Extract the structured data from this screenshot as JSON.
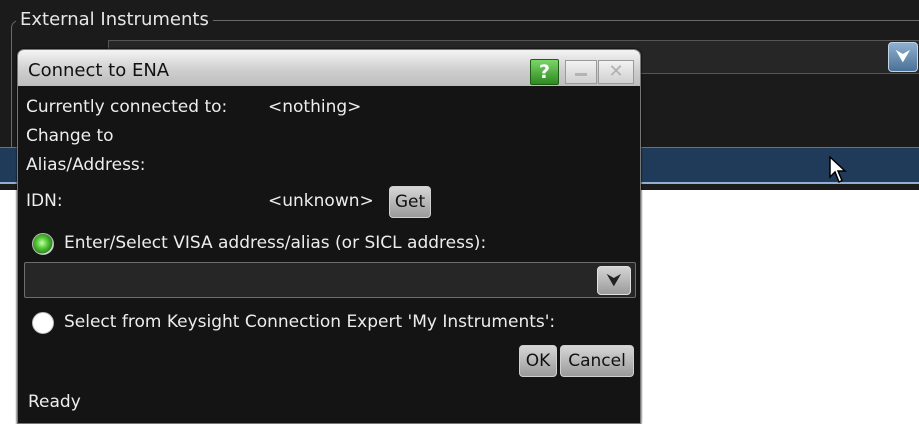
{
  "background": {
    "group_title": "External Instruments",
    "combo_dropdown_glyph": "⮟",
    "cursor_icon": "arrow-cursor"
  },
  "dialog": {
    "title": "Connect to ENA",
    "help_label": "?",
    "close_glyph": "✕",
    "currently_connected_label": "Currently connected to:",
    "currently_connected_value": "<nothing>",
    "change_to_label": "Change to",
    "alias_address_label": "Alias/Address:",
    "idn_label": "IDN:",
    "idn_value": "<unknown>",
    "get_button": "Get",
    "radio_visa_label": "Enter/Select VISA address/alias (or SICL address):",
    "radio_visa_selected": true,
    "visa_combo_value": "",
    "visa_combo_glyph": "⮟",
    "radio_keysight_label": "Select from Keysight Connection Expert 'My Instruments':",
    "radio_keysight_selected": false,
    "ok_button": "OK",
    "cancel_button": "Cancel",
    "status": "Ready"
  },
  "colors": {
    "accent_green": "#2c8a1d",
    "selection_blue": "#203b5a",
    "dialog_bg": "#141414"
  }
}
